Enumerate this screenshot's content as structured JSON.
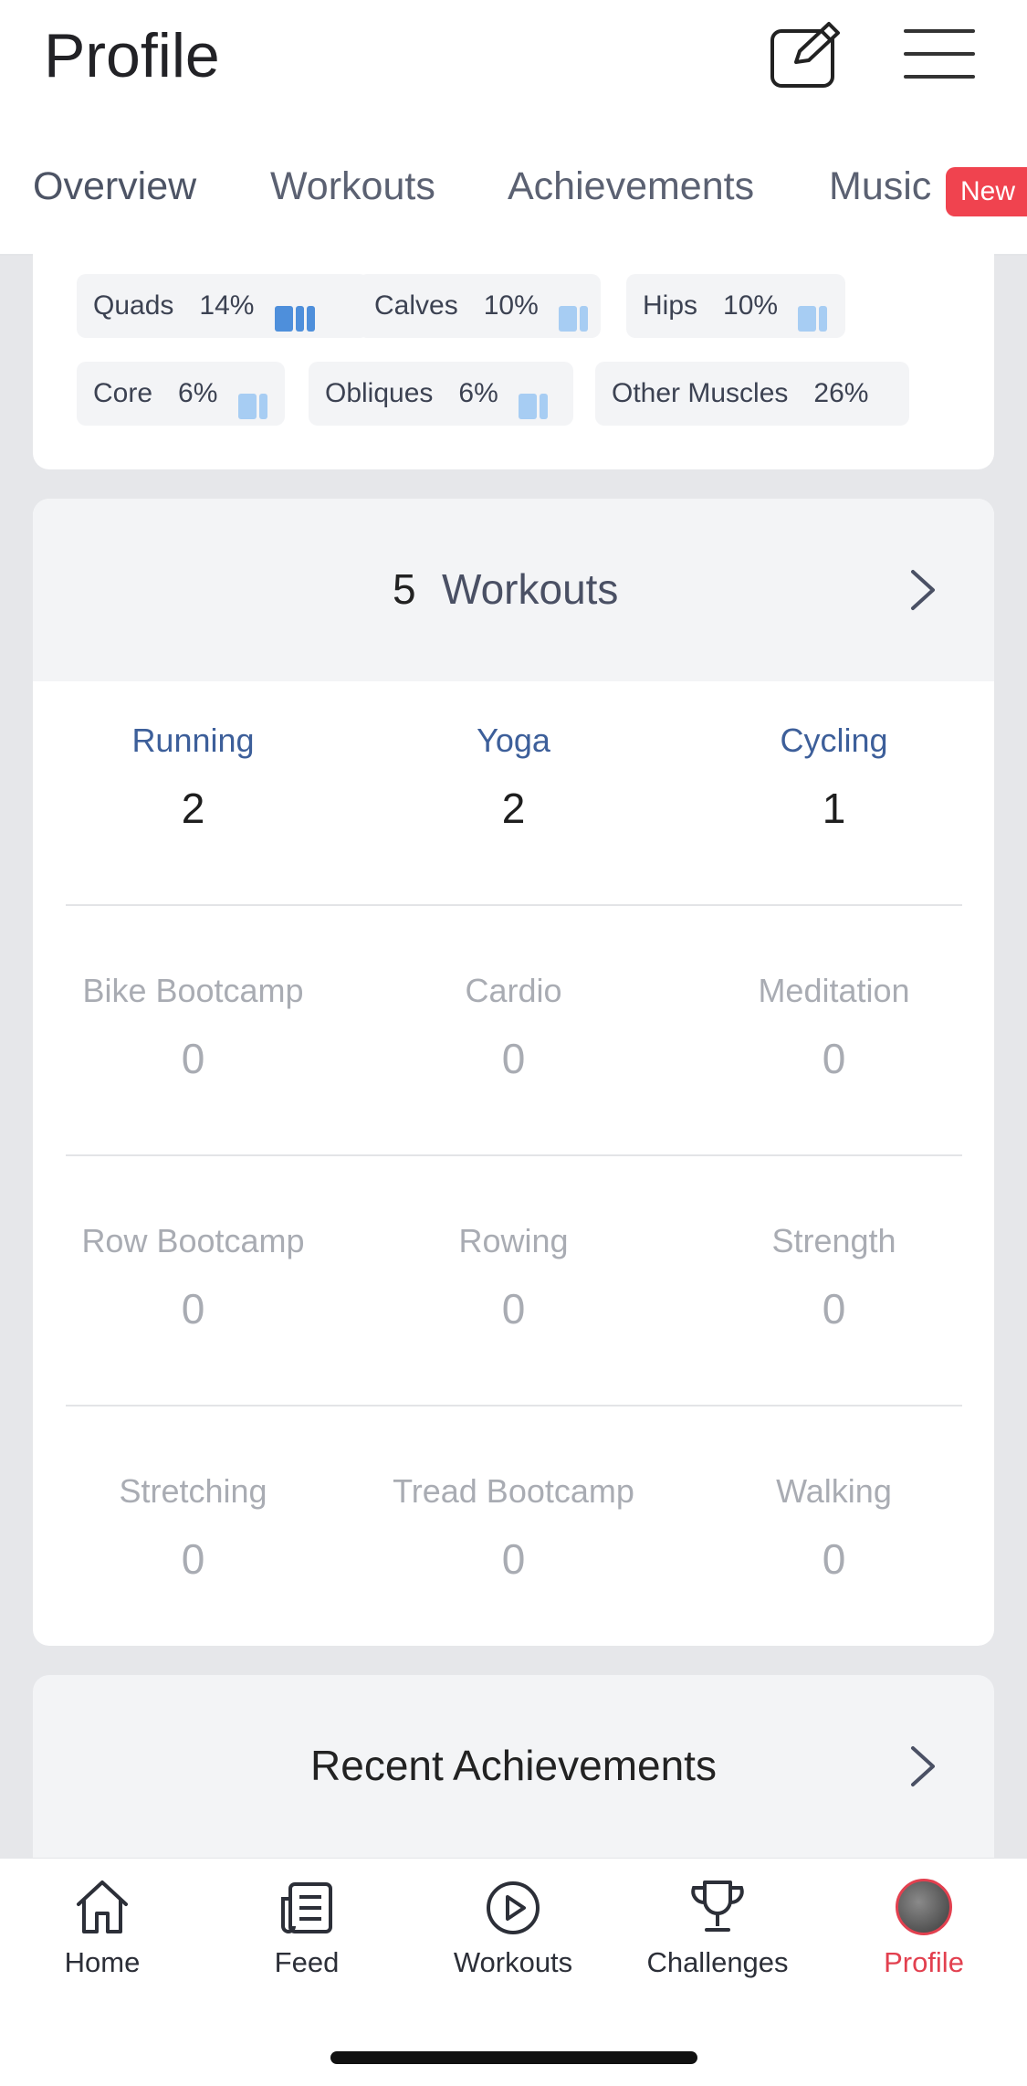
{
  "header": {
    "title": "Profile",
    "edit_icon": "edit-icon",
    "menu_icon": "hamburger-menu-icon"
  },
  "tabs": [
    {
      "label": "Overview",
      "active": true
    },
    {
      "label": "Workouts",
      "active": false
    },
    {
      "label": "Achievements",
      "active": false
    },
    {
      "label": "Music",
      "active": false,
      "badge": "New"
    }
  ],
  "muscles": [
    {
      "name": "Quads",
      "percent": "14%"
    },
    {
      "name": "Calves",
      "percent": "10%"
    },
    {
      "name": "Hips",
      "percent": "10%"
    },
    {
      "name": "Core",
      "percent": "6%"
    },
    {
      "name": "Obliques",
      "percent": "6%"
    },
    {
      "name": "Other Muscles",
      "percent": "26%"
    }
  ],
  "workouts": {
    "count": "5",
    "title": "Workouts",
    "types": [
      {
        "label": "Running",
        "count": "2"
      },
      {
        "label": "Yoga",
        "count": "2"
      },
      {
        "label": "Cycling",
        "count": "1"
      },
      {
        "label": "Bike Bootcamp",
        "count": "0"
      },
      {
        "label": "Cardio",
        "count": "0"
      },
      {
        "label": "Meditation",
        "count": "0"
      },
      {
        "label": "Row Bootcamp",
        "count": "0"
      },
      {
        "label": "Rowing",
        "count": "0"
      },
      {
        "label": "Strength",
        "count": "0"
      },
      {
        "label": "Stretching",
        "count": "0"
      },
      {
        "label": "Tread Bootcamp",
        "count": "0"
      },
      {
        "label": "Walking",
        "count": "0"
      }
    ]
  },
  "achievements": {
    "title": "Recent Achievements"
  },
  "bottom_nav": [
    {
      "label": "Home",
      "icon": "home-icon"
    },
    {
      "label": "Feed",
      "icon": "feed-icon"
    },
    {
      "label": "Workouts",
      "icon": "play-circle-icon"
    },
    {
      "label": "Challenges",
      "icon": "trophy-icon"
    },
    {
      "label": "Profile",
      "icon": "avatar",
      "active": true
    }
  ],
  "colors": {
    "accent": "#e2404f",
    "highlight_label": "#3d5f9a",
    "muscle_bar": "#4e8fdb"
  }
}
